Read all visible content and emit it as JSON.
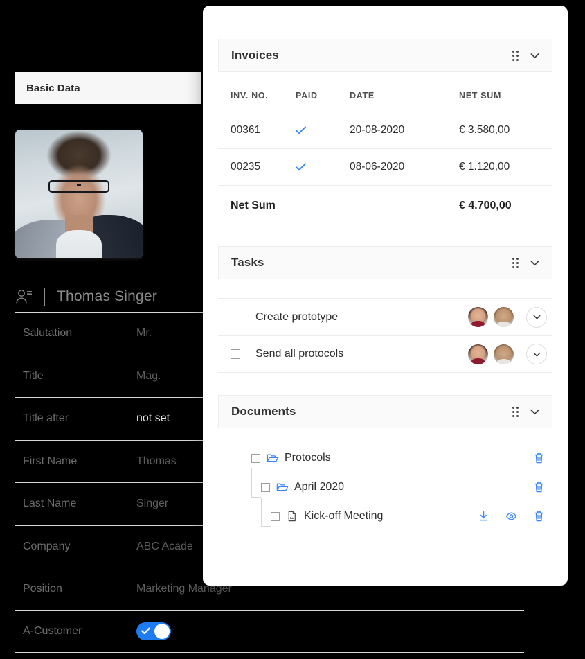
{
  "theme": {
    "page_bg": "#000000",
    "panel_bg": "#ffffff",
    "accent_blue": "#3b86f7",
    "icon_blue": "#3b86f7",
    "header_bg": "#fafafa",
    "muted_text": "#9b9b9b"
  },
  "left_panel": {
    "header_title": "Basic Data",
    "contact": {
      "icon": "person-badge-icon",
      "name": "Thomas Singer"
    },
    "fields": [
      {
        "label": "Salutation",
        "value": "Mr.",
        "type": "text",
        "highlight": false
      },
      {
        "label": "Title",
        "value": "Mag.",
        "type": "text",
        "highlight": false
      },
      {
        "label": "Title after",
        "value": "not set",
        "type": "text",
        "highlight": true
      },
      {
        "label": "First Name",
        "value": "Thomas",
        "type": "text",
        "highlight": false
      },
      {
        "label": "Last Name",
        "value": "Singer",
        "type": "text",
        "highlight": false
      },
      {
        "label": "Company",
        "value": "ABC Acade",
        "type": "text",
        "highlight": false
      },
      {
        "label": "Position",
        "value": "Marketing Manager",
        "type": "text",
        "highlight": false
      },
      {
        "label": "A-Customer",
        "value": "on",
        "type": "toggle",
        "highlight": false
      }
    ]
  },
  "panel": {
    "cards": [
      {
        "title": "Invoices",
        "drag_icon": "drag-handle-icon",
        "collapse_icon": "chevron-down-icon"
      },
      {
        "title": "Tasks",
        "drag_icon": "drag-handle-icon",
        "collapse_icon": "chevron-down-icon"
      },
      {
        "title": "Documents",
        "drag_icon": "drag-handle-icon",
        "collapse_icon": "chevron-down-icon"
      }
    ],
    "invoices": {
      "columns": [
        "INV. NO.",
        "PAID",
        "DATE",
        "NET SUM"
      ],
      "rows": [
        {
          "inv_no": "00361",
          "paid": true,
          "paid_icon": "check-icon",
          "date": "20-08-2020",
          "net_sum": "€ 3.580,00",
          "muted": true
        },
        {
          "inv_no": "00235",
          "paid": true,
          "paid_icon": "check-icon",
          "date": "08-06-2020",
          "net_sum": "€ 1.120,00",
          "muted": false
        }
      ],
      "total_label": "Net Sum",
      "total_value": "€ 4.700,00"
    },
    "tasks": {
      "items": [
        {
          "label": "Create prototype",
          "checked": false,
          "assignees": 2,
          "expand_icon": "chevron-down-icon"
        },
        {
          "label": "Send all protocols",
          "checked": false,
          "assignees": 2,
          "expand_icon": "chevron-down-icon"
        }
      ]
    },
    "documents": {
      "items": [
        {
          "label": "Protocols",
          "type": "folder",
          "icon": "folder-open-icon",
          "depth": 0,
          "checked": false,
          "actions": [
            {
              "name": "delete-icon"
            }
          ]
        },
        {
          "label": "April 2020",
          "type": "folder",
          "icon": "folder-open-icon",
          "depth": 1,
          "checked": false,
          "actions": [
            {
              "name": "delete-icon"
            }
          ]
        },
        {
          "label": "Kick-off Meeting",
          "type": "file",
          "icon": "file-icon",
          "depth": 2,
          "checked": false,
          "actions": [
            {
              "name": "download-icon"
            },
            {
              "name": "preview-icon"
            },
            {
              "name": "delete-icon"
            }
          ]
        }
      ]
    }
  }
}
